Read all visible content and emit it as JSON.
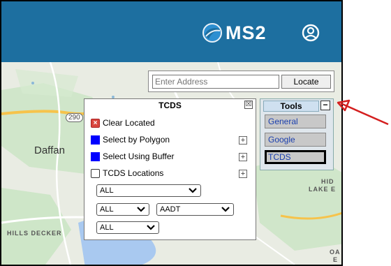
{
  "header": {
    "brand": "MS2",
    "user_icon": "user-circle-icon"
  },
  "address": {
    "placeholder": "Enter Address",
    "locate_label": "Locate"
  },
  "map": {
    "labels": {
      "route": "290",
      "daffan": "Daffan",
      "hills_decker": "HILLS DECKER",
      "hid": "HID",
      "lake": "LAKE E",
      "oa": "OA",
      "e": "E"
    }
  },
  "tcds": {
    "title": "TCDS",
    "close": "☒",
    "items": {
      "clear": "Clear Located",
      "polygon": "Select by Polygon",
      "buffer": "Select Using Buffer",
      "locations": "TCDS Locations"
    },
    "selects": {
      "region": "ALL",
      "type": "ALL",
      "measure": "AADT",
      "year": "ALL"
    }
  },
  "tools": {
    "title": "Tools",
    "buttons": {
      "general": "General",
      "google": "Google",
      "tcds": "TCDS"
    },
    "active": "TCDS"
  },
  "colors": {
    "header": "#1d6fa0",
    "arrow": "#d41f1f",
    "select_icon": "#0000ff",
    "clear_icon": "#d9463f"
  }
}
